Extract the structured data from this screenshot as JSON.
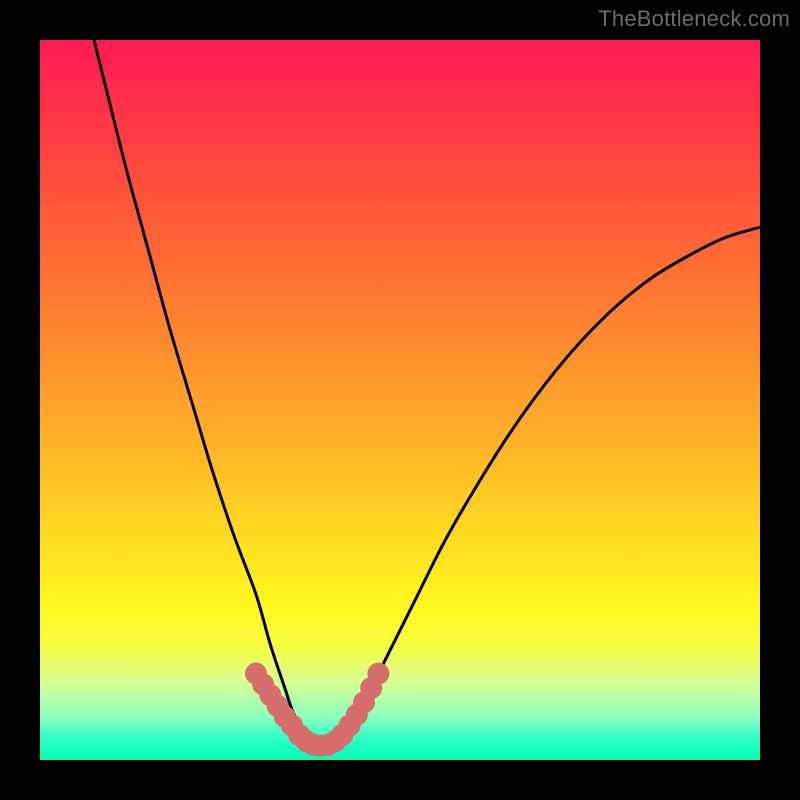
{
  "watermark": "TheBottleneck.com",
  "colors": {
    "frame": "#000000",
    "curve": "#000000",
    "marker": "#d86d6d",
    "gradient_top": "#ff1a54",
    "gradient_bottom": "#00ffb0"
  },
  "chart_data": {
    "type": "line",
    "title": "",
    "xlabel": "",
    "ylabel": "",
    "xlim": [
      0,
      100
    ],
    "ylim": [
      0,
      100
    ],
    "x": [
      0,
      3,
      6,
      9,
      12,
      15,
      18,
      21,
      24,
      27,
      30,
      32,
      34,
      35,
      36,
      37,
      38,
      39,
      40,
      41,
      42,
      43,
      45,
      48,
      52,
      56,
      60,
      65,
      70,
      75,
      80,
      85,
      90,
      95,
      100
    ],
    "y": [
      130,
      118,
      106,
      94,
      82,
      71,
      60,
      50,
      40,
      31,
      23,
      16,
      10,
      7,
      5,
      3.3,
      2.2,
      2,
      2,
      2.5,
      3.5,
      5,
      8,
      14,
      22,
      30,
      37,
      45,
      52,
      58,
      63,
      67,
      70,
      72.5,
      74
    ],
    "markers": {
      "x": [
        30,
        31,
        32,
        33,
        34,
        35,
        36,
        37,
        38,
        39,
        40,
        41,
        42,
        43,
        44,
        45,
        46,
        47
      ],
      "y": [
        12,
        10.5,
        9,
        7.5,
        6,
        4.8,
        3.5,
        2.6,
        2.1,
        2,
        2.1,
        2.6,
        3.5,
        4.8,
        6.3,
        8,
        10,
        12
      ],
      "radius": 11
    },
    "annotations": []
  }
}
